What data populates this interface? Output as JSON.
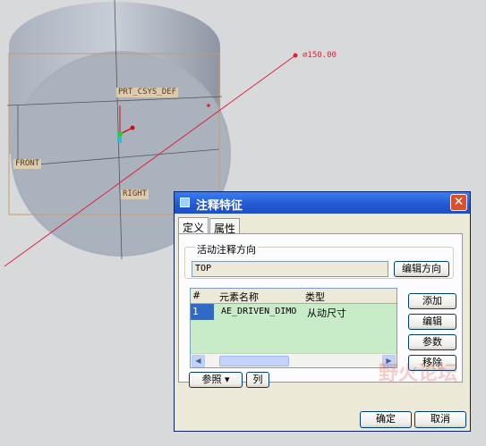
{
  "viewport": {
    "dimension_label": "⌀150.00",
    "datum_labels": {
      "csys": "PRT_CSYS_DEF",
      "front": "FRONT",
      "right": "RIGHT"
    }
  },
  "dialog": {
    "title": "注释特征",
    "close_glyph": "✕",
    "tabs": [
      {
        "label": "定义",
        "active": true
      },
      {
        "label": "属性",
        "active": false
      }
    ],
    "orientation_group": {
      "label": "活动注释方向",
      "value": "TOP",
      "edit_button": "编辑方向"
    },
    "table": {
      "columns": [
        "#",
        "元素名称",
        "类型"
      ],
      "rows": [
        {
          "num": "1",
          "name": "AE_DRIVEN_DIMO",
          "type": "从动尺寸"
        }
      ],
      "scroll_left": "◀",
      "scroll_right": "▶"
    },
    "side_buttons": [
      "添加",
      "编辑",
      "参数",
      "移除"
    ],
    "bottom_buttons": {
      "reference": "参照 ▾",
      "column": "列"
    },
    "footer": {
      "ok": "确定",
      "cancel": "取消"
    }
  },
  "watermark": {
    "text": "野火论坛"
  }
}
